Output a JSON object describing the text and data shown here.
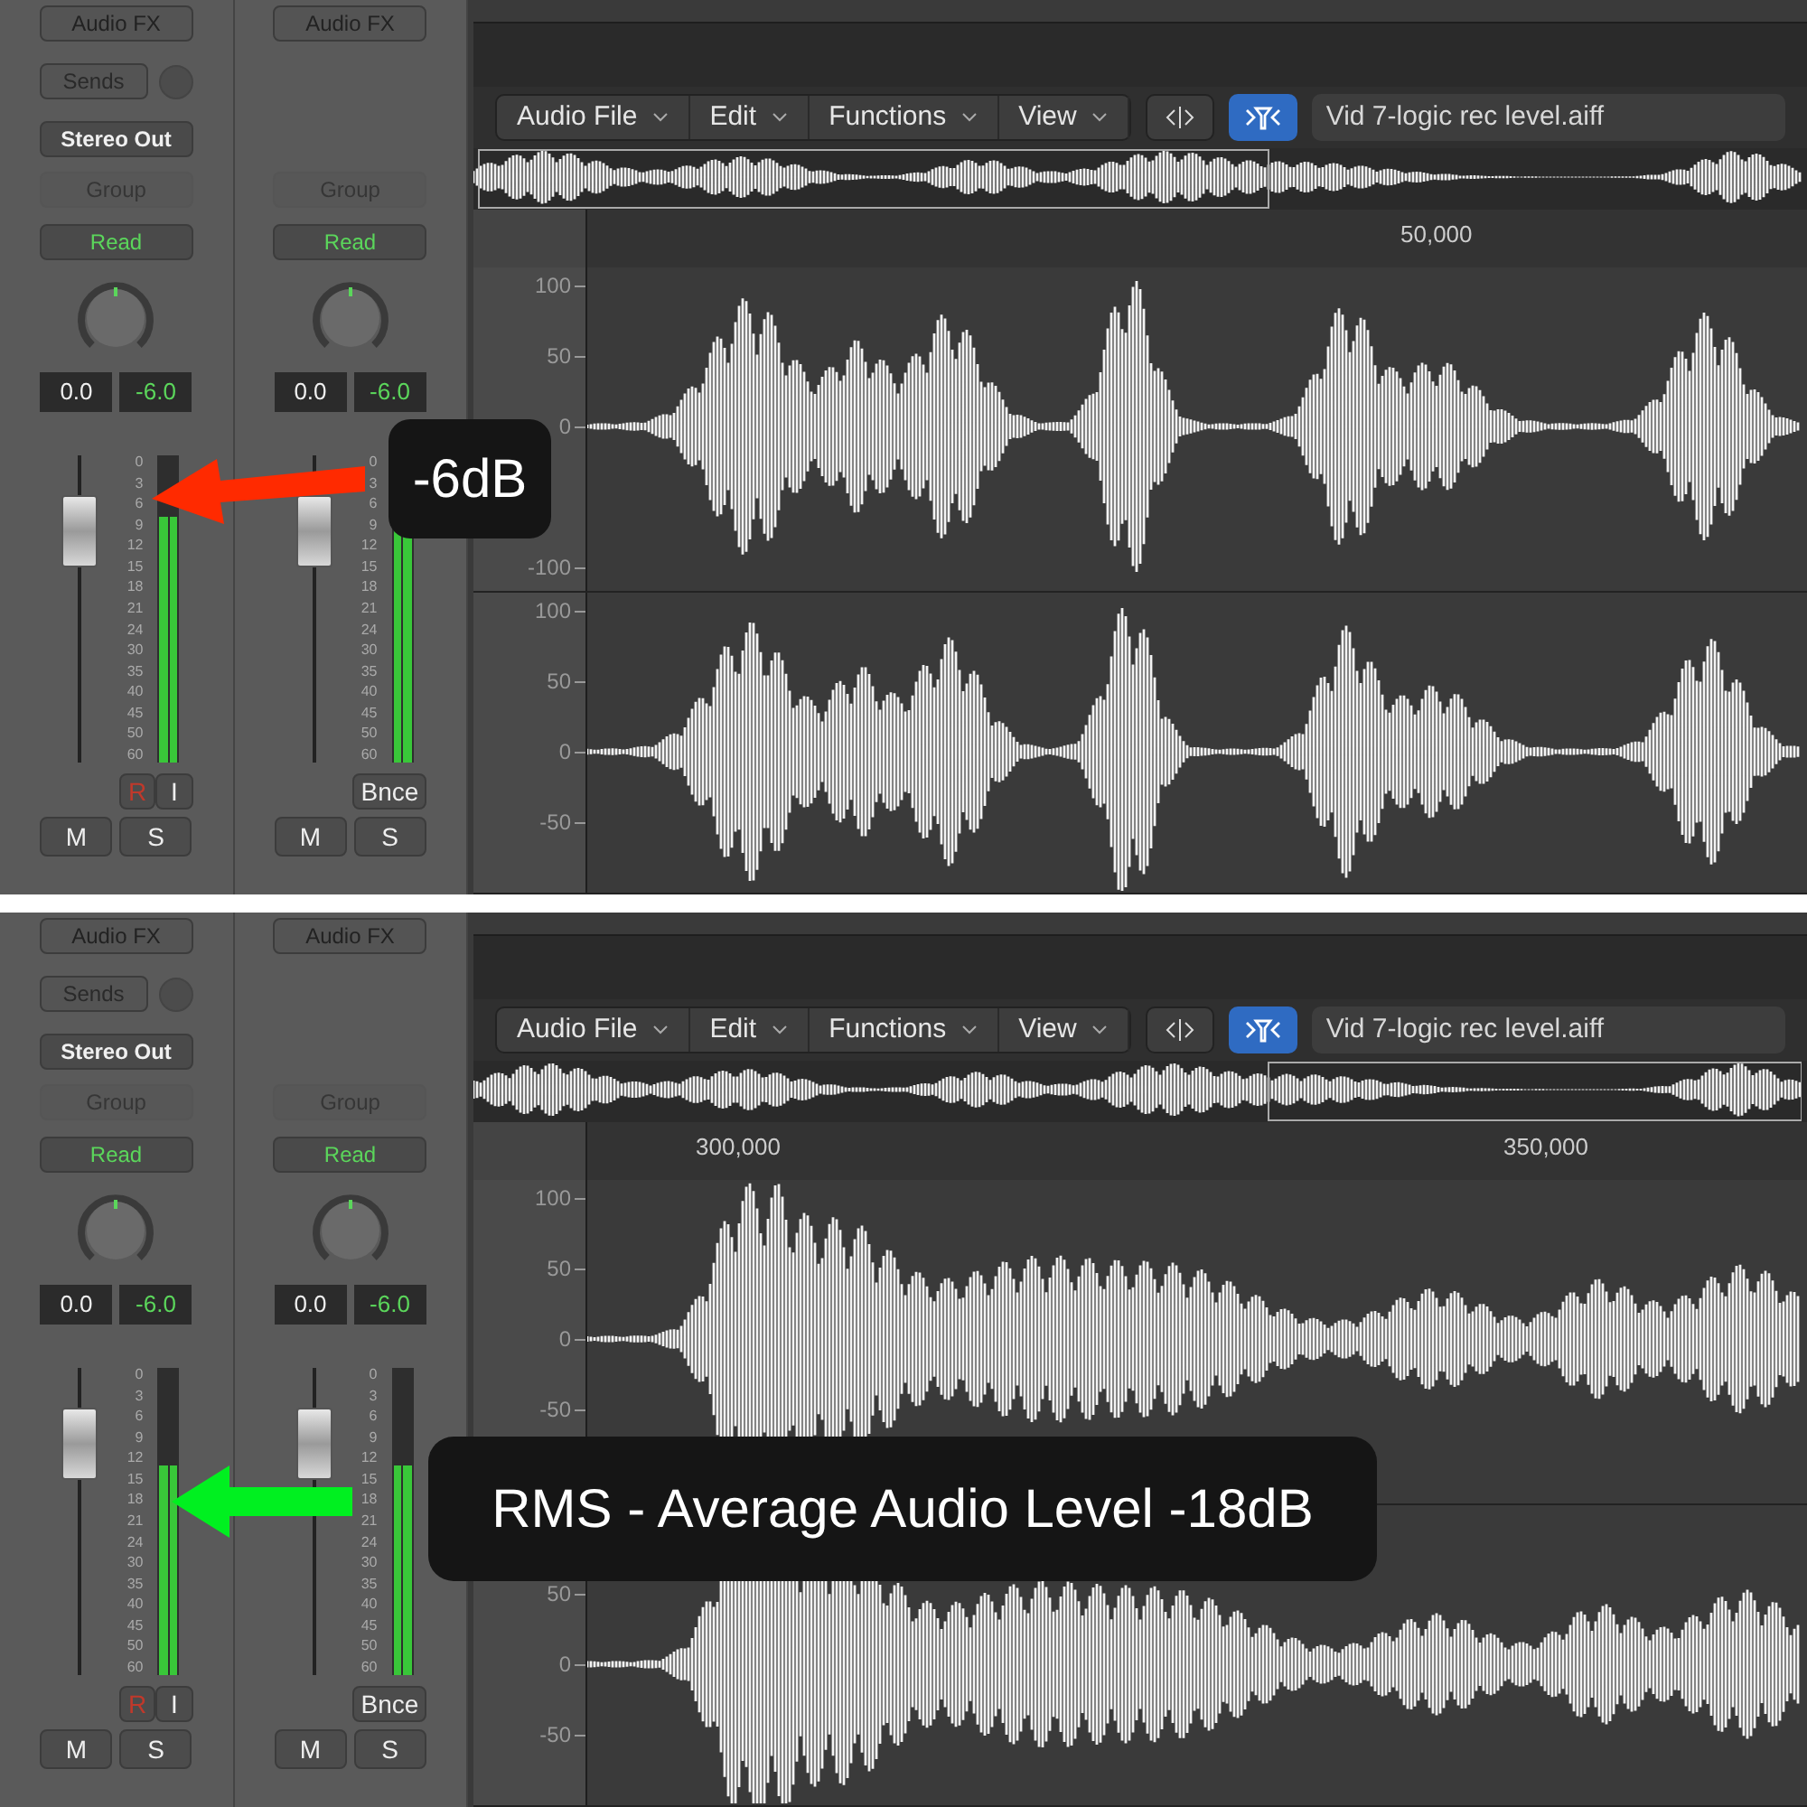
{
  "panels": [
    {
      "strips": [
        {
          "kind": "track",
          "audio_fx": "Audio FX",
          "sends": "Sends",
          "output": "Stereo Out",
          "group": "Group",
          "automation": "Read",
          "pan_value": "0.0",
          "volume_value": "-6.0",
          "meter_scale": [
            "0",
            "3",
            "6",
            "9",
            "12",
            "15",
            "18",
            "21",
            "24",
            "30",
            "35",
            "40",
            "45",
            "50",
            "60"
          ],
          "level": 0.8,
          "buttons_top": [
            "R",
            "I"
          ],
          "mute": "M",
          "solo": "S"
        },
        {
          "kind": "master",
          "audio_fx": "Audio FX",
          "group": "Group",
          "automation": "Read",
          "pan_value": "0.0",
          "volume_value": "-6.0",
          "meter_scale": [
            "0",
            "3",
            "6",
            "9",
            "12",
            "15",
            "18",
            "21",
            "24",
            "30",
            "35",
            "40",
            "45",
            "50",
            "60"
          ],
          "level": 0.8,
          "buttons_top": [
            "Bnce"
          ],
          "mute": "M",
          "solo": "S"
        }
      ],
      "editor": {
        "menus": [
          "Audio File",
          "Edit",
          "Functions",
          "View"
        ],
        "file_name": "Vid 7-logic rec level.aiff",
        "ruler_labels": [
          "50,000"
        ],
        "channel_1_axis": [
          {
            "kind": "max",
            "label": "100"
          },
          {
            "kind": "half",
            "label": "50"
          },
          {
            "kind": "zero",
            "label": "0"
          },
          {
            "kind": "min",
            "label": "-100"
          }
        ],
        "channel_2_axis": [
          {
            "kind": "max",
            "label": "100"
          },
          {
            "kind": "half",
            "label": "50"
          },
          {
            "kind": "zero",
            "label": "0"
          },
          {
            "kind": "neghalf",
            "label": "-50"
          }
        ]
      },
      "callout": {
        "text": "-6dB",
        "arrow": {
          "color": "#ff2a00"
        }
      }
    },
    {
      "strips": [
        {
          "kind": "track",
          "audio_fx": "Audio FX",
          "sends": "Sends",
          "output": "Stereo Out",
          "group": "Group",
          "automation": "Read",
          "pan_value": "0.0",
          "volume_value": "-6.0",
          "meter_scale": [
            "0",
            "3",
            "6",
            "9",
            "12",
            "15",
            "18",
            "21",
            "24",
            "30",
            "35",
            "40",
            "45",
            "50",
            "60"
          ],
          "level": 0.68,
          "buttons_top": [
            "R",
            "I"
          ],
          "mute": "M",
          "solo": "S"
        },
        {
          "kind": "master",
          "audio_fx": "Audio FX",
          "group": "Group",
          "automation": "Read",
          "pan_value": "0.0",
          "volume_value": "-6.0",
          "meter_scale": [
            "0",
            "3",
            "6",
            "9",
            "12",
            "15",
            "18",
            "21",
            "24",
            "30",
            "35",
            "40",
            "45",
            "50",
            "60"
          ],
          "level": 0.68,
          "buttons_top": [
            "Bnce"
          ],
          "mute": "M",
          "solo": "S"
        }
      ],
      "editor": {
        "menus": [
          "Audio File",
          "Edit",
          "Functions",
          "View"
        ],
        "file_name": "Vid 7-logic rec level.aiff",
        "ruler_labels": [
          "300,000",
          "350,000"
        ],
        "channel_1_axis": [
          {
            "kind": "max",
            "label": "100"
          },
          {
            "kind": "half",
            "label": "50"
          },
          {
            "kind": "zero",
            "label": "0"
          },
          {
            "kind": "neghalf",
            "label": "-50"
          }
        ],
        "channel_2_axis": [
          {
            "kind": "half",
            "label": "50"
          },
          {
            "kind": "zero",
            "label": "0"
          },
          {
            "kind": "neghalf",
            "label": "-50"
          }
        ]
      },
      "callout": {
        "text": "RMS - Average Audio Level -18dB",
        "arrow": {
          "color": "#00f020"
        }
      }
    }
  ]
}
